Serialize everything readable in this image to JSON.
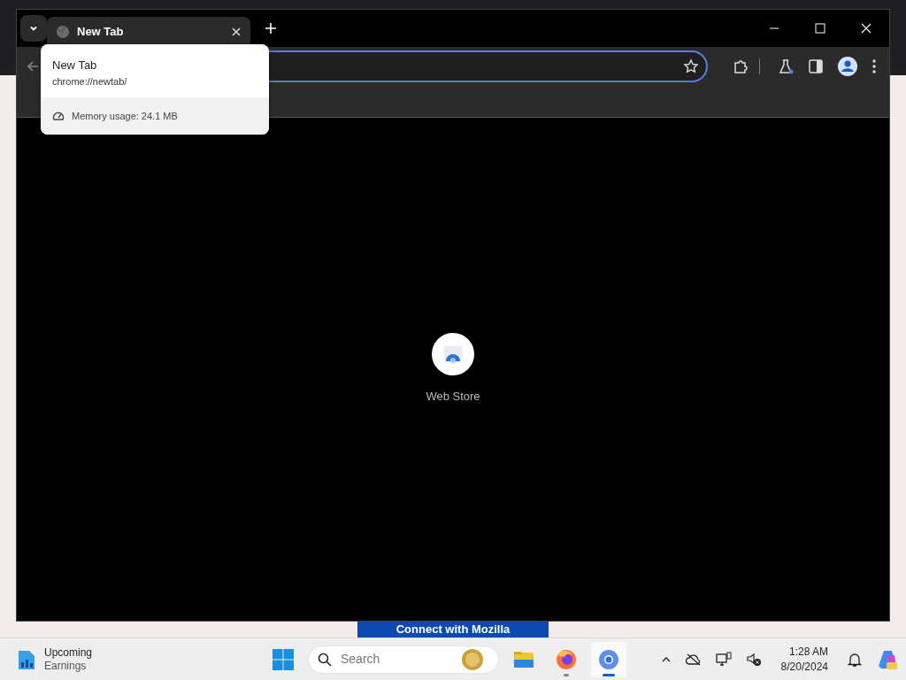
{
  "browser": {
    "tab": {
      "title": "New Tab",
      "selected": true
    },
    "omnibox": {
      "focused": true
    },
    "hover_card": {
      "title": "New Tab",
      "url": "chrome://newtab/",
      "memory": "Memory usage: 24.1 MB"
    },
    "shortcut": {
      "label": "Web Store"
    }
  },
  "background_button": "Connect with Mozilla",
  "taskbar": {
    "widget": {
      "title": "Upcoming",
      "subtitle": "Earnings"
    },
    "search": {
      "placeholder": "Search"
    },
    "apps": [
      {
        "kind": "files",
        "running": false,
        "active": false
      },
      {
        "kind": "firefox",
        "running": true,
        "active": false
      },
      {
        "kind": "chrome",
        "running": true,
        "active": true
      }
    ],
    "time": "1:28 AM",
    "date": "8/20/2024"
  }
}
